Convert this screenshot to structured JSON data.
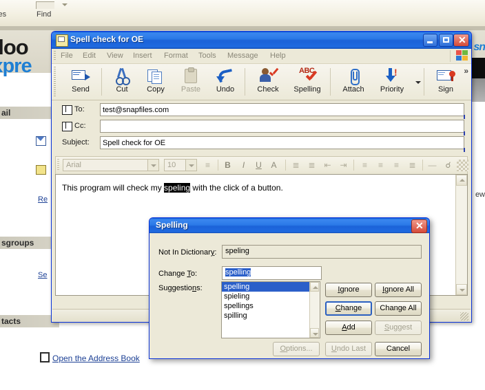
{
  "background": {
    "toolbar": {
      "item_partial": "ses",
      "find_label": "Find"
    },
    "logo": {
      "line1": "utloo",
      "line2": "Expre"
    },
    "sections": {
      "mail": "ail",
      "newsgroups": "sgroups",
      "contacts": "tacts"
    },
    "links": {
      "read_mail": "Re",
      "setup_account": "Se",
      "address_book": "Open the Address Book"
    },
    "msn_logo": "sn",
    "clipped_text": "ew"
  },
  "compose_window": {
    "title": "Spell check for OE",
    "title_icon": "message-icon",
    "window_buttons": {
      "minimize": "minimize-icon",
      "maximize": "maximize-icon",
      "close": "✕"
    },
    "menu": [
      "File",
      "Edit",
      "View",
      "Insert",
      "Format",
      "Tools",
      "Message",
      "Help"
    ],
    "toolbar": [
      {
        "label": "Send",
        "icon": "send-icon",
        "enabled": true
      },
      {
        "label": "Cut",
        "icon": "cut-icon",
        "enabled": true
      },
      {
        "label": "Copy",
        "icon": "copy-icon",
        "enabled": true
      },
      {
        "label": "Paste",
        "icon": "paste-icon",
        "enabled": false
      },
      {
        "label": "Undo",
        "icon": "undo-icon",
        "enabled": true
      },
      {
        "label": "Check",
        "icon": "check-names-icon",
        "enabled": true
      },
      {
        "label": "Spelling",
        "icon": "spelling-abc-icon",
        "enabled": true
      },
      {
        "label": "Attach",
        "icon": "paperclip-icon",
        "enabled": true
      },
      {
        "label": "Priority",
        "icon": "priority-arrow-icon",
        "enabled": true
      },
      {
        "label": "Sign",
        "icon": "digital-signature-icon",
        "enabled": true
      }
    ],
    "toolbar_overflow": "»",
    "fields": {
      "to_label": "To:",
      "to_value": "test@snapfiles.com",
      "cc_label": "Cc:",
      "cc_value": "",
      "subject_label": "Subject:",
      "subject_value": "Spell check for OE"
    },
    "format_bar": {
      "font_name": "Arial",
      "font_size": "10",
      "buttons": [
        "paragraph-style",
        "bold",
        "italic",
        "underline",
        "font-color",
        "ordered-list",
        "unordered-list",
        "decrease-indent",
        "increase-indent",
        "align-left",
        "align-center",
        "align-right",
        "justify",
        "horizontal-rule",
        "insert-link",
        "insert-image"
      ]
    },
    "body": {
      "before": "This program will check my ",
      "selected_word": "speling",
      "after": " with the click of a button."
    }
  },
  "spelling_dialog": {
    "title": "Spelling",
    "close_label": "✕",
    "not_in_dictionary_label": "Not In Dictionar",
    "not_in_dictionary_label_accel": "y",
    "not_in_dictionary_label_tail": ":",
    "not_in_dictionary_value": "speling",
    "change_to_label_a": "Change ",
    "change_to_label_accel": "T",
    "change_to_label_tail": "o:",
    "change_to_value": "spelling",
    "suggestions_label_a": "Suggestio",
    "suggestions_label_accel": "n",
    "suggestions_label_tail": "s:",
    "suggestions": [
      "spelling",
      "spieling",
      "spellings",
      "spilling"
    ],
    "selected_suggestion_index": 0,
    "buttons": [
      {
        "id": "ignore",
        "pre": "",
        "accel": "I",
        "post": "gnore",
        "enabled": true,
        "default": false
      },
      {
        "id": "ignore-all",
        "pre": "",
        "accel": "I",
        "post": "gnore All",
        "enabled": true,
        "default": false
      },
      {
        "id": "change",
        "pre": "",
        "accel": "C",
        "post": "hange",
        "enabled": true,
        "default": true
      },
      {
        "id": "change-all",
        "pre": "",
        "accel": "",
        "post": "Change All",
        "enabled": true,
        "default": false
      },
      {
        "id": "add",
        "pre": "",
        "accel": "A",
        "post": "dd",
        "enabled": true,
        "default": false
      },
      {
        "id": "suggest",
        "pre": "",
        "accel": "S",
        "post": "uggest",
        "enabled": false,
        "default": false
      },
      {
        "id": "options",
        "pre": "",
        "accel": "O",
        "post": "ptions...",
        "enabled": false,
        "default": false
      },
      {
        "id": "undo-last",
        "pre": "",
        "accel": "U",
        "post": "ndo Last",
        "enabled": false,
        "default": false
      },
      {
        "id": "cancel",
        "pre": "",
        "accel": "",
        "post": "Cancel",
        "enabled": true,
        "default": false
      }
    ]
  },
  "colors": {
    "title_blue": "#1b62d8",
    "window_face": "#ece9d8",
    "selection_blue": "#2b5fc9",
    "accent_red": "#d44a38",
    "link_blue": "#1b3f94"
  }
}
